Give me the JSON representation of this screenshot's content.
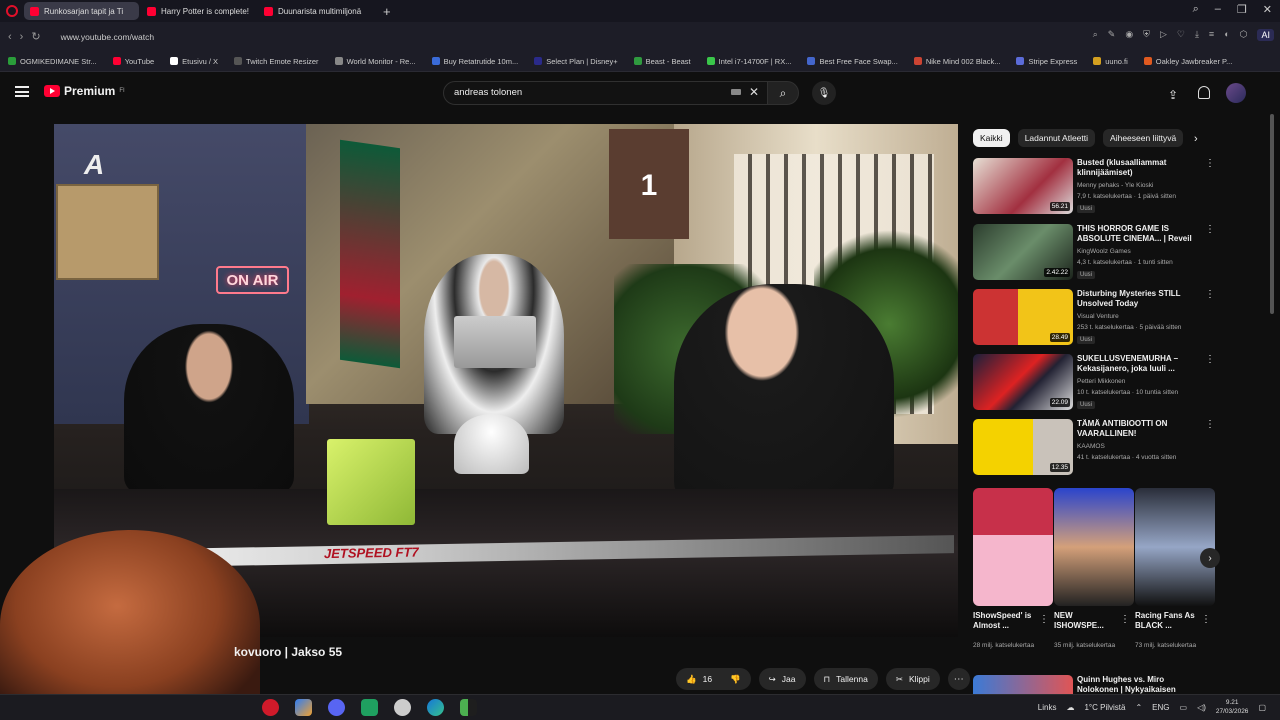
{
  "browser": {
    "tabs": [
      {
        "label": "Runkosarjan tapit ja Ti",
        "active": true
      },
      {
        "label": "Harry Potter is complete!",
        "active": false
      },
      {
        "label": "Duunarista multimiljonä",
        "active": false
      }
    ],
    "url": "www.youtube.com/watch",
    "ai_label": "AI",
    "bookmarks": [
      "OGMIKEDIMANE Str...",
      "YouTube",
      "Etusivu / X",
      "Twitch Emote Resizer",
      "World Monitor - Re...",
      "Buy Retatrutide 10m...",
      "Select Plan | Disney+",
      "Beast - Beast",
      "Intel i7-14700F | RX...",
      "Best Free Face Swap...",
      "Nike Mind 002 Black...",
      "Stripe Express",
      "uuno.fi",
      "Oakley Jawbreaker P..."
    ]
  },
  "youtube": {
    "logo_text": "Premium",
    "logo_region": "FI",
    "search_value": "andreas tolonen",
    "video": {
      "title": "kovuoro | Jakso 55",
      "onair_text": "ON AIR",
      "stick_text": "JETSPEED FT7"
    },
    "actions": {
      "likes": "16",
      "share": "Jaa",
      "save": "Tallenna",
      "clip": "Klippi"
    },
    "chips": [
      "Kaikki",
      "Ladannut Atleetti",
      "Aiheeseen liittyvä"
    ],
    "recommendations": [
      {
        "title": "Busted (klusaalliammat klinnijäämiset)",
        "channel": "Menny pehaks - Yle Kioski",
        "meta": "7,9 t. katselukertaa · 1 päivä sitten",
        "badge": "Uusi",
        "duration": "56.21"
      },
      {
        "title": "THIS HORROR GAME IS ABSOLUTE CINEMA... | Reveil",
        "channel": "KingWoolz Games",
        "meta": "4,3 t. katselukertaa · 1 tunti sitten",
        "badge": "Uusi",
        "duration": "2.42.22"
      },
      {
        "title": "Disturbing Mysteries STILL Unsolved Today",
        "channel": "Visual Venture",
        "meta": "253 t. katselukertaa · 5 päivää sitten",
        "badge": "Uusi",
        "duration": "28.49"
      },
      {
        "title": "SUKELLUSVENEMURHA – Kekasijanero, joka luuli ...",
        "channel": "Petteri Mikkonen",
        "meta": "10 t. katselukertaa · 10 tuntia sitten",
        "badge": "Uusi",
        "duration": "22.09"
      },
      {
        "title": "TÄMÄ ANTIBIOOTTI ON VAARALLINEN!",
        "channel": "KAAMOS",
        "meta": "41 t. katselukertaa · 4 vuotta sitten",
        "badge": "",
        "duration": "12.35"
      }
    ],
    "shorts": [
      {
        "title": "IShowSpeed' is Almost ...",
        "views": "28 milj. katselukertaa"
      },
      {
        "title": "NEW ISHOWSPE...",
        "views": "35 milj. katselukertaa"
      },
      {
        "title": "Racing Fans As BLACK ...",
        "views": "73 milj. katselukertaa"
      }
    ],
    "last_rec_title": "Quinn Hughes vs. Miro Nolokonen | Nykyaikaisen"
  },
  "taskbar": {
    "links": "Links",
    "weather": "1°C  Pilvistä",
    "lang": "ENG",
    "time": "9.21",
    "date": "27/03/2026"
  }
}
